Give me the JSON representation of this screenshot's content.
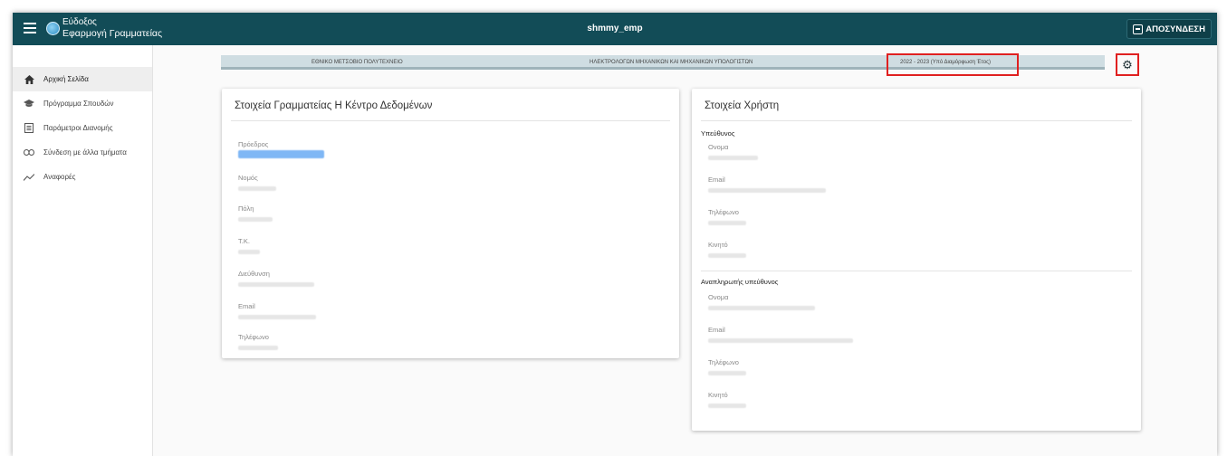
{
  "app": {
    "title_line1": "Εύδοξος",
    "title_line2": "Εφαρμογή Γραμματείας",
    "user": "shmmy_emp",
    "logout_label": "ΑΠΟΣΥΝΔΕΣΗ"
  },
  "sidebar": {
    "items": [
      {
        "label": "Αρχική Σελίδα",
        "icon": "home-icon"
      },
      {
        "label": "Πρόγραμμα Σπουδών",
        "icon": "school-icon"
      },
      {
        "label": "Παράμετροι Διανομής",
        "icon": "list-icon"
      },
      {
        "label": "Σύνδεση με άλλα τμήματα",
        "icon": "link-icon"
      },
      {
        "label": "Αναφορές",
        "icon": "chart-line-icon"
      }
    ]
  },
  "infobar": {
    "institution": "ΕΘΝΙΚΟ ΜΕΤΣΟΒΙΟ ΠΟΛΥΤΕΧΝΕΙΟ",
    "department": "ΗΛΕΚΤΡΟΛΟΓΩΝ ΜΗΧΑΝΙΚΩΝ ΚΑΙ ΜΗΧΑΝΙΚΩΝ ΥΠΟΛΟΓΙΣΤΩΝ",
    "year": "2022 - 2023 (Υπό Διαμόρφωση Έτος)"
  },
  "left_card": {
    "title": "Στοιχεία Γραμματείας Η Κέντρο Δεδομένων",
    "fields": [
      "Πρόεδρος",
      "Νομός",
      "Πόλη",
      "Τ.Κ.",
      "Διεύθυνση",
      "Email",
      "Τηλέφωνο"
    ]
  },
  "right_card": {
    "title": "Στοιχεία Χρήστη",
    "section1": "Υπεύθυνος",
    "section1_fields": [
      "Ονομα",
      "Email",
      "Τηλέφωνο",
      "Κινητό"
    ],
    "section2": "Αναπληρωτής υπεύθυνος",
    "section2_fields": [
      "Ονομα",
      "Email",
      "Τηλέφωνο",
      "Κινητό"
    ]
  },
  "colors": {
    "header": "#124c57",
    "infobar": "#cfdde2",
    "highlight": "#e02020"
  }
}
